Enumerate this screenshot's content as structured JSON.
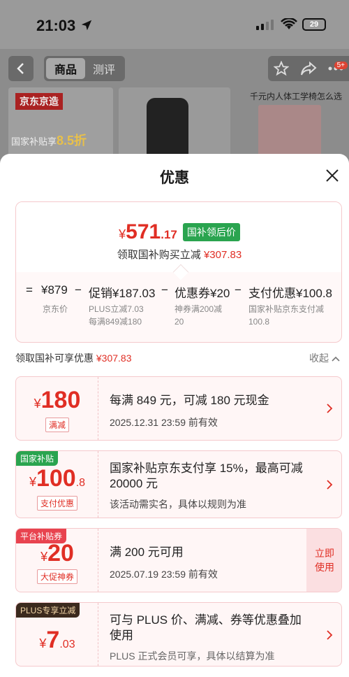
{
  "status_bar": {
    "time": "21:03",
    "battery": "29"
  },
  "nav": {
    "tabs": [
      "商品",
      "测评"
    ],
    "cart_badge": "5+"
  },
  "banner": {
    "brand": "京东京造",
    "subsidy_prefix": "国家补贴享",
    "subsidy_value": "8.5折",
    "right_title": "千元内人体工学椅怎么选"
  },
  "sheet": {
    "title": "优惠",
    "summary": {
      "currency": "¥",
      "price_int": "571",
      "price_dec": ".17",
      "price_tag": "国补领后价",
      "sub_prefix": "领取国补购买立减",
      "sub_amount": "¥307.83",
      "formula": [
        {
          "op": "=",
          "value": "¥879",
          "label": "京东价"
        },
        {
          "op": "−",
          "value": "促销¥187.03",
          "label": "PLUS立减7.03\n每满849减180"
        },
        {
          "op": "−",
          "value": "优惠券¥20",
          "label": "神券满200减\n20"
        },
        {
          "op": "−",
          "value": "支付优惠¥100.8",
          "label": "国家补贴京东支付减\n100.8"
        }
      ]
    },
    "section": {
      "prefix": "领取国补可享优惠",
      "amount": "¥307.83",
      "collapse": "收起"
    },
    "cards": [
      {
        "currency": "¥",
        "int": "180",
        "dec": "",
        "kind": "满减",
        "corner": "",
        "main": "每满 849 元，可减 180 元现金",
        "note": "2025.12.31 23:59 前有效",
        "button": ""
      },
      {
        "currency": "¥",
        "int": "100",
        "dec": ".8",
        "kind": "支付优惠",
        "corner": "国家补贴",
        "main": "国家补贴京东支付享 15%，最高可减\n20000 元",
        "note": "该活动需实名，具体以规则为准",
        "button": ""
      },
      {
        "currency": "¥",
        "int": "20",
        "dec": "",
        "kind": "大促神券",
        "corner": "平台补贴券",
        "main": "满 200 元可用",
        "note": "2025.07.19 23:59 前有效",
        "button": "立即\n使用"
      },
      {
        "currency": "¥",
        "int": "7",
        "dec": ".03",
        "kind": "",
        "corner": "PLUS专享立减",
        "main": "可与 PLUS 价、满减、券等优惠叠加\n使用",
        "note": "PLUS 正式会员可享，具体以结算为准",
        "button": ""
      }
    ]
  }
}
